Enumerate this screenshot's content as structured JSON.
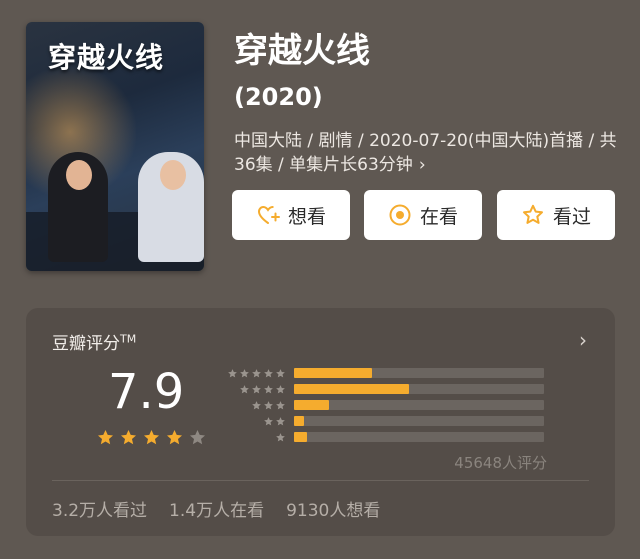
{
  "movie": {
    "poster_title": "穿越火线",
    "title": "穿越火线",
    "year": "(2020)",
    "meta": "中国大陆 / 剧情 / 2020-07-20(中国大陆)首播 / 共36集 / 单集片长63分钟",
    "meta_chevron": "›"
  },
  "actions": {
    "want": "想看",
    "watching": "在看",
    "watched": "看过"
  },
  "rating": {
    "panel_title": "豆瓣评分",
    "trademark": "TM",
    "arrow": "›",
    "score": "7.9",
    "stars_filled": 4,
    "stars_total": 5,
    "distribution": [
      {
        "stars": 5,
        "fraction": 0.31
      },
      {
        "stars": 4,
        "fraction": 0.46
      },
      {
        "stars": 3,
        "fraction": 0.14
      },
      {
        "stars": 2,
        "fraction": 0.04
      },
      {
        "stars": 1,
        "fraction": 0.05
      }
    ],
    "count": "45648人评分"
  },
  "stats": {
    "watched": "3.2万人看过",
    "watching": "1.4万人在看",
    "want": "9130人想看"
  },
  "colors": {
    "background": "#5f5852",
    "panel": "#544d48",
    "accent": "#f5ac2e",
    "star_empty": "#8e8882"
  }
}
